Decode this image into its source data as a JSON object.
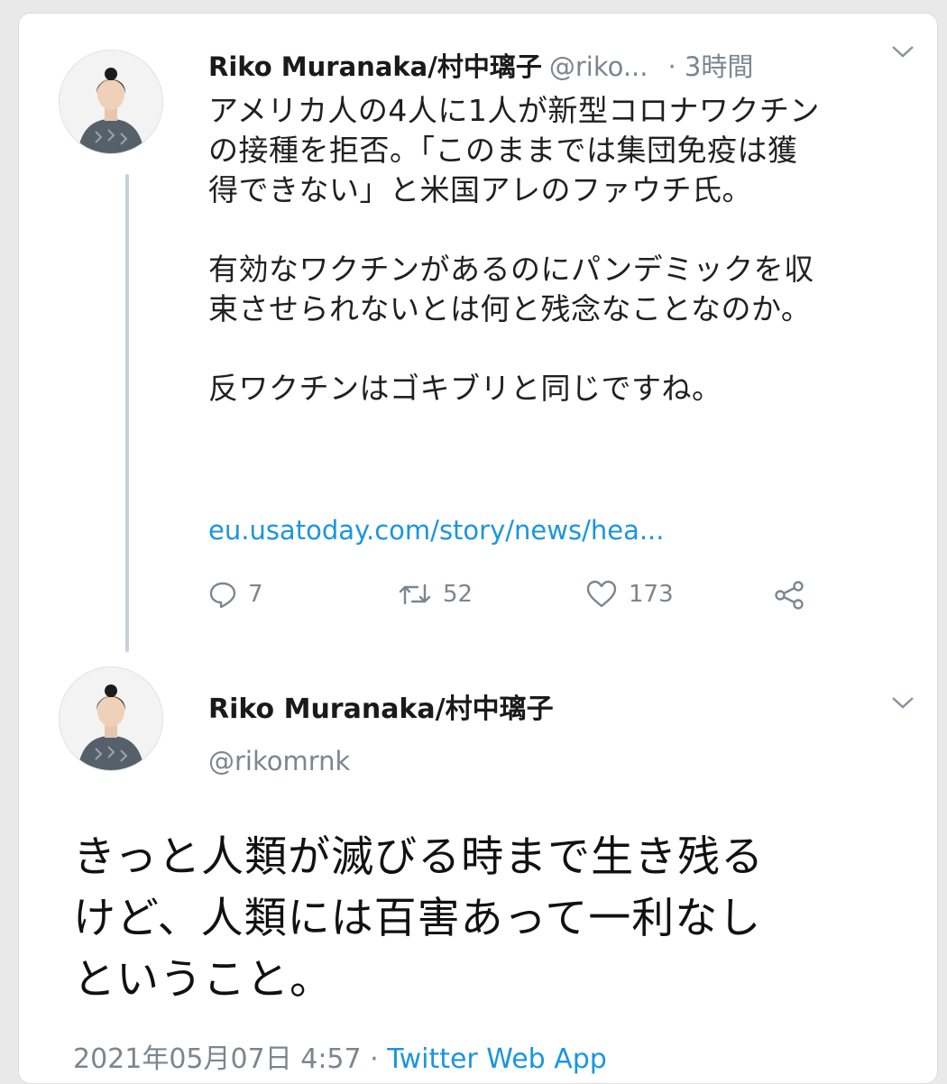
{
  "colors": {
    "link": "#1b95e0",
    "muted": "#7b868f",
    "text": "#202020",
    "thread_line": "#c9d1d8"
  },
  "tweet1": {
    "display_name": "Riko Muranaka/村中璃子",
    "handle": "@riko...",
    "time": "· 3時間",
    "menu_icon": "chevron-down-icon",
    "paragraphs": [
      [
        "アメリカ人の4人に1人が新型コロナワクチン",
        "の接種を拒否。「このままでは集団免疫は獲",
        "得できない」と米国アレのファウチ氏。"
      ],
      [
        "有効なワクチンがあるのにパンデミックを収",
        "束させられないとは何と残念なことなのか。"
      ],
      [
        "反ワクチンはゴキブリと同じですね。"
      ]
    ],
    "link": "eu.usatoday.com/story/news/hea...",
    "actions": {
      "reply": {
        "icon": "reply-icon",
        "count": "7"
      },
      "retweet": {
        "icon": "retweet-icon",
        "count": "52"
      },
      "like": {
        "icon": "heart-icon",
        "count": "173"
      },
      "share": {
        "icon": "share-icon"
      }
    }
  },
  "tweet2": {
    "display_name": "Riko Muranaka/村中璃子",
    "handle": "@rikomrnk",
    "menu_icon": "chevron-down-icon",
    "lines": [
      "きっと人類が滅びる時まで生き残る",
      "けど、人類には百害あって一利なし",
      "ということ。"
    ],
    "timestamp": "2021年05月07日 4:57",
    "separator": " · ",
    "source": "Twitter Web App"
  }
}
